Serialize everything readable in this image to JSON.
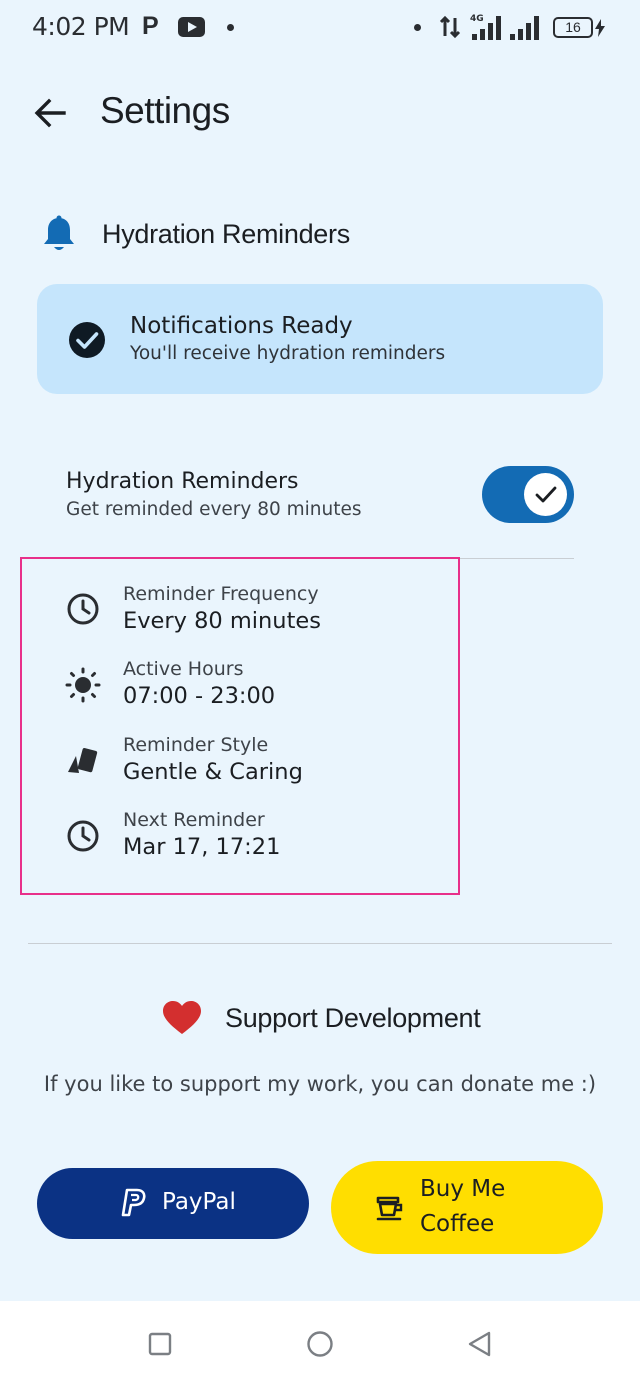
{
  "status_bar": {
    "time": "4:02 PM",
    "p_icon_letter": "P",
    "network_label": "4G",
    "battery": "16"
  },
  "header": {
    "title": "Settings",
    "back_icon": "arrow-left-icon"
  },
  "hydration": {
    "section_title": "Hydration Reminders",
    "bell_icon": "bell-icon",
    "notification_card": {
      "title": "Notifications Ready",
      "subtitle": "You'll receive hydration reminders",
      "icon": "check-circle-icon"
    },
    "toggle": {
      "title": "Hydration Reminders",
      "subtitle": "Get reminded every 80 minutes",
      "enabled": true
    },
    "details": [
      {
        "icon": "clock-icon",
        "label": "Reminder Frequency",
        "value": "Every 80 minutes"
      },
      {
        "icon": "sun-icon",
        "label": "Active Hours",
        "value": "07:00 - 23:00"
      },
      {
        "icon": "style-cards-icon",
        "label": "Reminder Style",
        "value": "Gentle & Caring"
      },
      {
        "icon": "clock-icon",
        "label": "Next Reminder",
        "value": "Mar 17, 17:21"
      }
    ]
  },
  "support": {
    "title": "Support Development",
    "heart_icon": "heart-icon",
    "description": "If you like to support my work, you can donate me :)",
    "paypal_label": "PayPal",
    "coffee_label_line1": "Buy Me",
    "coffee_label_line2": "Coffee"
  },
  "colors": {
    "background": "#eaf5fd",
    "accent": "#136bb4",
    "card": "#c5e5fc",
    "paypal": "#0b3284",
    "coffee": "#ffde00",
    "heart": "#d32f2f",
    "highlight": "#e8308a"
  }
}
